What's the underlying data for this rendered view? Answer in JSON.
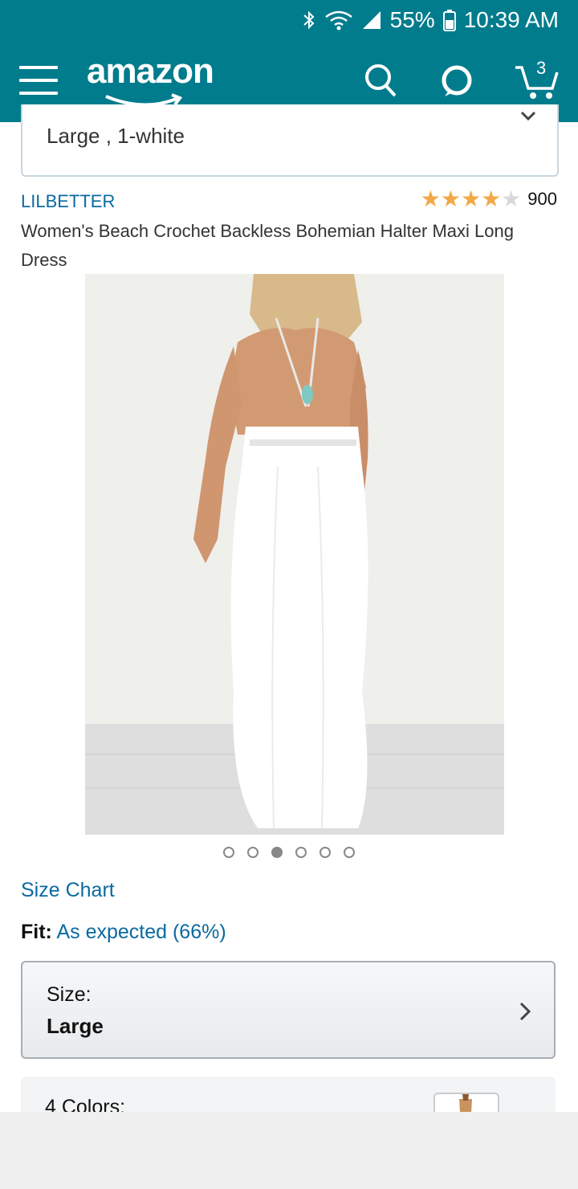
{
  "status": {
    "battery": "55%",
    "time": "10:39 AM"
  },
  "header": {
    "logo": "amazon",
    "cart_count": "3"
  },
  "variant": {
    "text": "Large , 1-white"
  },
  "product": {
    "brand": "LILBETTER",
    "rating_stars": 4,
    "rating_count": "900",
    "title": "Women's Beach Crochet Backless Bohemian Halter Maxi Long Dress"
  },
  "carousel": {
    "total": 6,
    "active": 3
  },
  "size_chart": "Size Chart",
  "fit": {
    "label": "Fit:",
    "value": "As expected (66%)"
  },
  "size": {
    "label": "Size:",
    "value": "Large"
  },
  "colors": {
    "label": "4 Colors:"
  },
  "colors_theme": {
    "primary": "#017c8d",
    "link": "#0a6aa1",
    "star": "#f3a847"
  }
}
